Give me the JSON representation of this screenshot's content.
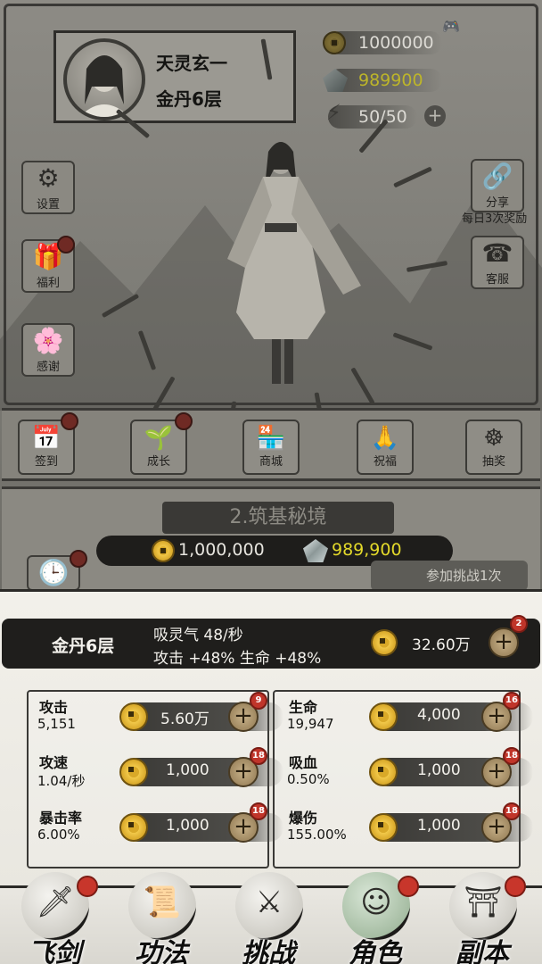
{
  "player": {
    "name": "天灵玄一",
    "realm": "金丹6层"
  },
  "resources": {
    "gold": "1000000",
    "spirit_stones": "989900",
    "stamina": "50/50"
  },
  "side_buttons": {
    "settings": "设置",
    "welfare": "福利",
    "thanks": "感谢",
    "share": "分享",
    "share_caption": "每日3次奖励",
    "service": "客服"
  },
  "bar_buttons": [
    "签到",
    "成长",
    "商城",
    "祝福",
    "抽奖"
  ],
  "dungeon": {
    "title": "2.筑基秘境",
    "gold_cost": "1,000,000",
    "stone_cost": "989,900",
    "join_label": "参加挑战1次"
  },
  "cultivation": {
    "realm": "金丹6层",
    "rate": "吸灵气 48/秒",
    "bonus": "攻击 +48%  生命 +48%",
    "cost": "32.60万",
    "badge": "2"
  },
  "stats": [
    {
      "label": "攻击",
      "value": "5,151",
      "cost": "5.60万",
      "badge": "9"
    },
    {
      "label": "生命",
      "value": "19,947",
      "cost": "4,000",
      "badge": "16"
    },
    {
      "label": "攻速",
      "value": "1.04/秒",
      "cost": "1,000",
      "badge": "18"
    },
    {
      "label": "吸血",
      "value": "0.50%",
      "cost": "1,000",
      "badge": "18"
    },
    {
      "label": "暴击率",
      "value": "6.00%",
      "cost": "1,000",
      "badge": "18"
    },
    {
      "label": "爆伤",
      "value": "155.00%",
      "cost": "1,000",
      "badge": "18"
    }
  ],
  "nav": [
    {
      "label": "飞剑",
      "icon": "flying-sword-icon",
      "glyph": "🗡"
    },
    {
      "label": "功法",
      "icon": "scroll-icon",
      "glyph": "📜"
    },
    {
      "label": "挑战",
      "icon": "crossed-swords-icon",
      "glyph": "⚔"
    },
    {
      "label": "角色",
      "icon": "character-icon",
      "glyph": "☺"
    },
    {
      "label": "副本",
      "icon": "dungeon-gate-icon",
      "glyph": "⛩"
    }
  ],
  "colors": {
    "gold": "#f2c94a",
    "stone_yellow": "#e3d92a",
    "badge_red": "#c8362b"
  }
}
